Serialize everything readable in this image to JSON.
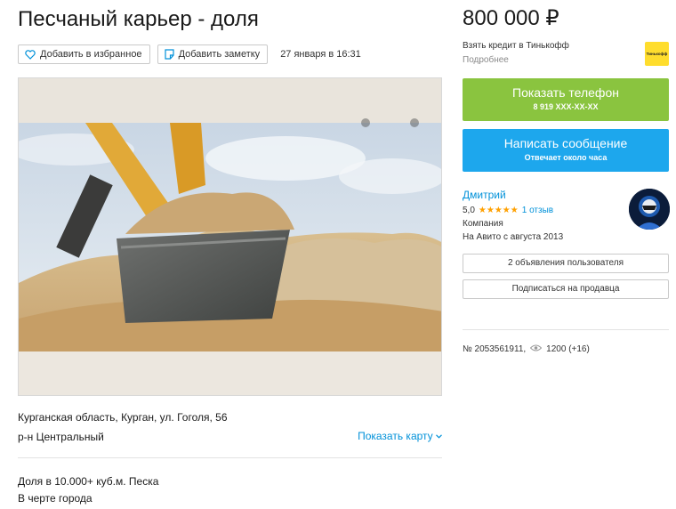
{
  "listing": {
    "title": "Песчаный карьер - доля",
    "date": "27 января в 16:31",
    "address": "Курганская область, Курган, ул. Гоголя, 56",
    "district": "р-н Центральный",
    "show_map": "Показать карту",
    "description_lines": [
      "Доля в 10.000+ куб.м. Песка",
      "В черте города"
    ]
  },
  "actions": {
    "favorite": "Добавить в избранное",
    "note": "Добавить заметку"
  },
  "price": {
    "value": "800 000 ₽",
    "credit": "Взять кредит в Тинькофф",
    "credit_more": "Подробнее",
    "bank_logo": "Тинькофф"
  },
  "contact": {
    "phone_label": "Показать телефон",
    "phone_masked": "8 919 XXX-XX-XX",
    "message_label": "Написать сообщение",
    "message_sub": "Отвечает около часа"
  },
  "seller": {
    "name": "Дмитрий",
    "rating": "5,0",
    "rating_value": 5,
    "stars": "★★★★★",
    "reviews": "1 отзыв",
    "type": "Компания",
    "since": "На Авито с августа 2013",
    "ads_button": "2 объявления пользователя",
    "subscribe_button": "Подписаться на продавца"
  },
  "meta": {
    "ad_number": "№ 2053561911,",
    "views": "1200 (+16)"
  },
  "colors": {
    "phone_button": "#8ac43f",
    "message_button": "#1da7ed",
    "link": "#0091d9",
    "star": "#ffa000",
    "bank_logo": "#ffdd2d"
  },
  "icons": {
    "favorite": "heart-icon",
    "note": "note-icon",
    "views": "eye-icon",
    "map": "chevron-down-icon"
  }
}
